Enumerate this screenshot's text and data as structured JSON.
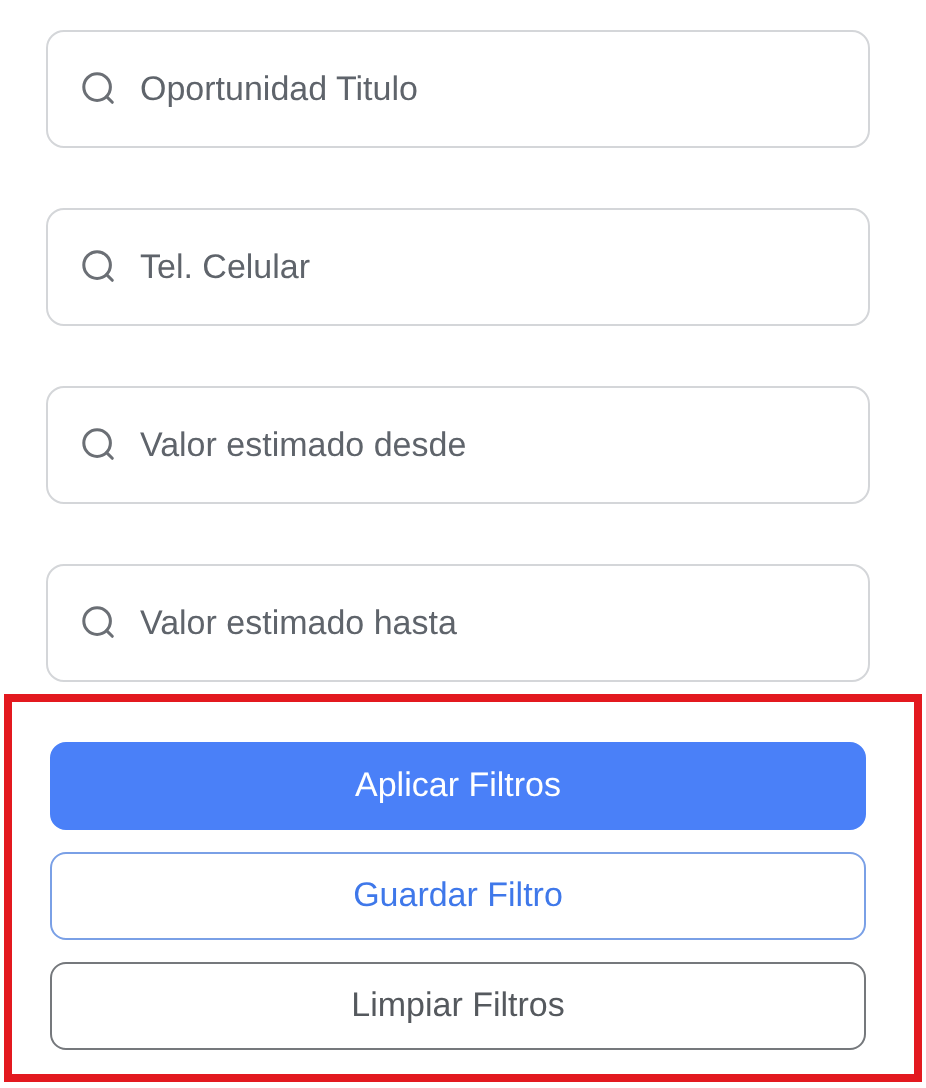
{
  "search_fields": [
    {
      "placeholder": "Oportunidad Titulo"
    },
    {
      "placeholder": "Tel. Celular"
    },
    {
      "placeholder": "Valor estimado desde"
    },
    {
      "placeholder": "Valor estimado hasta"
    }
  ],
  "actions": {
    "highlighted": true,
    "buttons": [
      {
        "label": "Aplicar Filtros",
        "kind": "primary"
      },
      {
        "label": "Guardar Filtro",
        "kind": "outline"
      },
      {
        "label": "Limpiar Filtros",
        "kind": "secondary"
      }
    ]
  }
}
